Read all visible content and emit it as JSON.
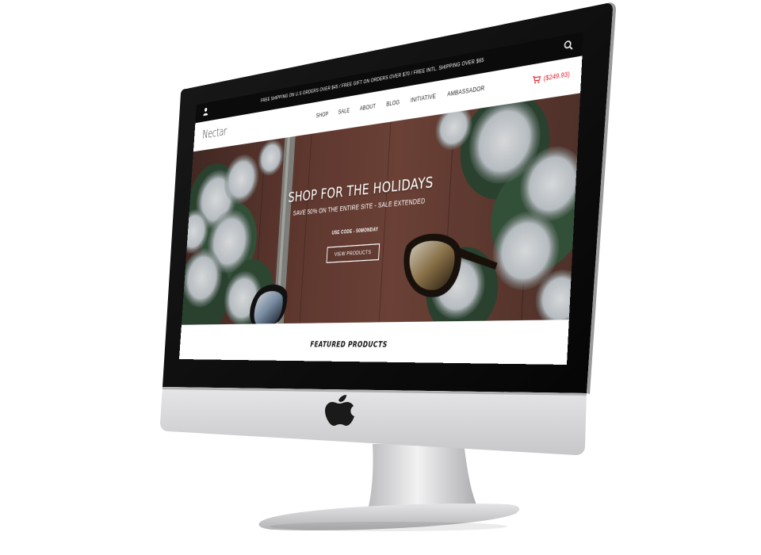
{
  "topbar": {
    "shipping_text": "FREE SHIPPING ON U.S ORDERS OVER $45 / FREE GIFT ON ORDERS OVER $70 / FREE INTL. SHIPPING OVER $65"
  },
  "header": {
    "logo": "Nectar",
    "nav": [
      "SHOP",
      "SALE",
      "ABOUT",
      "BLOG",
      "INITIATIVE",
      "AMBASSADOR"
    ],
    "cart_total": "($249.93)"
  },
  "hero": {
    "title": "SHOP FOR THE HOLIDAYS",
    "subtitle": "SAVE 50% ON THE ENTIRE SITE - SALE EXTENDED",
    "code": "USE CODE - 50MONDAY",
    "button": "VIEW PRODUCTS"
  },
  "featured": {
    "title": "FEATURED PRODUCTS"
  },
  "colors": {
    "topbar_bg": "#0b0b0b",
    "cart_accent": "#e0202a",
    "monitor_silver": "#d9d9db",
    "monitor_bezel": "#0a0a0a"
  }
}
